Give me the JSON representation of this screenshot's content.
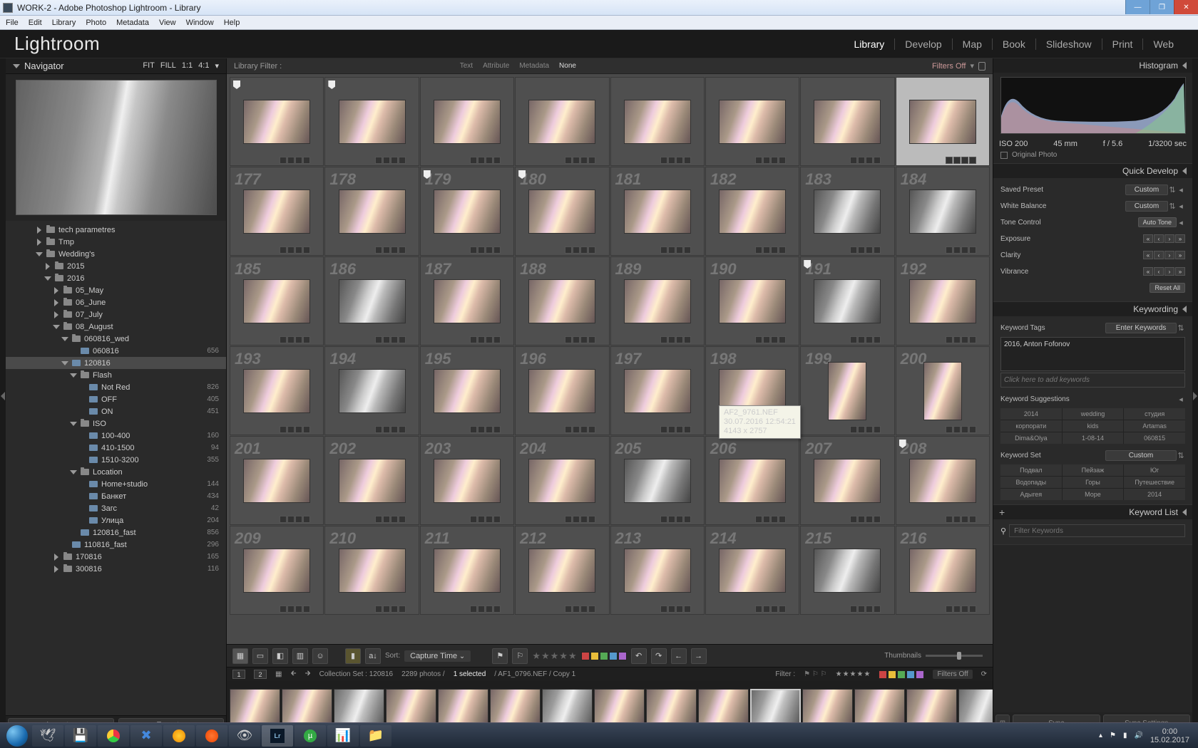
{
  "window": {
    "title": "WORK-2 - Adobe Photoshop Lightroom - Library",
    "menus": [
      "File",
      "Edit",
      "Library",
      "Photo",
      "Metadata",
      "View",
      "Window",
      "Help"
    ]
  },
  "brand": "Lightroom",
  "modules": [
    "Library",
    "Develop",
    "Map",
    "Book",
    "Slideshow",
    "Print",
    "Web"
  ],
  "activeModule": "Library",
  "navigator": {
    "title": "Navigator",
    "opts": [
      "FIT",
      "FILL",
      "1:1",
      "4:1"
    ]
  },
  "folders": [
    {
      "d": 3,
      "exp": "r",
      "ico": "f",
      "name": "tech parametres",
      "cnt": ""
    },
    {
      "d": 3,
      "exp": "r",
      "ico": "f",
      "name": "Tmp",
      "cnt": ""
    },
    {
      "d": 3,
      "exp": "d",
      "ico": "f",
      "name": "Wedding's",
      "cnt": ""
    },
    {
      "d": 4,
      "exp": "r",
      "ico": "f",
      "name": "2015",
      "cnt": ""
    },
    {
      "d": 4,
      "exp": "d",
      "ico": "f",
      "name": "2016",
      "cnt": ""
    },
    {
      "d": 5,
      "exp": "r",
      "ico": "f",
      "name": "05_May",
      "cnt": ""
    },
    {
      "d": 5,
      "exp": "r",
      "ico": "f",
      "name": "06_June",
      "cnt": ""
    },
    {
      "d": 5,
      "exp": "r",
      "ico": "f",
      "name": "07_July",
      "cnt": ""
    },
    {
      "d": 5,
      "exp": "d",
      "ico": "f",
      "name": "08_August",
      "cnt": ""
    },
    {
      "d": 6,
      "exp": "d",
      "ico": "f",
      "name": "060816_wed",
      "cnt": ""
    },
    {
      "d": 7,
      "exp": "",
      "ico": "s",
      "name": "060816",
      "cnt": "656"
    },
    {
      "d": 6,
      "exp": "d",
      "ico": "s",
      "name": "120816",
      "cnt": "",
      "sel": true
    },
    {
      "d": 7,
      "exp": "d",
      "ico": "f",
      "name": "Flash",
      "cnt": ""
    },
    {
      "d": 8,
      "exp": "",
      "ico": "s",
      "name": "Not Red",
      "cnt": "826"
    },
    {
      "d": 8,
      "exp": "",
      "ico": "s",
      "name": "OFF",
      "cnt": "405"
    },
    {
      "d": 8,
      "exp": "",
      "ico": "s",
      "name": "ON",
      "cnt": "451"
    },
    {
      "d": 7,
      "exp": "d",
      "ico": "f",
      "name": "ISO",
      "cnt": ""
    },
    {
      "d": 8,
      "exp": "",
      "ico": "s",
      "name": "100-400",
      "cnt": "160"
    },
    {
      "d": 8,
      "exp": "",
      "ico": "s",
      "name": "410-1500",
      "cnt": "94"
    },
    {
      "d": 8,
      "exp": "",
      "ico": "s",
      "name": "1510-3200",
      "cnt": "355"
    },
    {
      "d": 7,
      "exp": "d",
      "ico": "f",
      "name": "Location",
      "cnt": ""
    },
    {
      "d": 8,
      "exp": "",
      "ico": "s",
      "name": "Home+studio",
      "cnt": "144"
    },
    {
      "d": 8,
      "exp": "",
      "ico": "s",
      "name": "Банкет",
      "cnt": "434"
    },
    {
      "d": 8,
      "exp": "",
      "ico": "s",
      "name": "Загс",
      "cnt": "42"
    },
    {
      "d": 8,
      "exp": "",
      "ico": "s",
      "name": "Улица",
      "cnt": "204"
    },
    {
      "d": 7,
      "exp": "",
      "ico": "s",
      "name": "120816_fast",
      "cnt": "856"
    },
    {
      "d": 6,
      "exp": "",
      "ico": "s",
      "name": "110816_fast",
      "cnt": "296"
    },
    {
      "d": 5,
      "exp": "r",
      "ico": "f",
      "name": "170816",
      "cnt": "165"
    },
    {
      "d": 5,
      "exp": "r",
      "ico": "f",
      "name": "300816",
      "cnt": "116"
    }
  ],
  "impexp": {
    "import": "Import...",
    "export": "Export..."
  },
  "libFilter": {
    "label": "Library Filter :",
    "tabs": [
      "Text",
      "Attribute",
      "Metadata",
      "None"
    ],
    "active": "None",
    "filtersOff": "Filters Off"
  },
  "grid": {
    "startIndex": 169,
    "selectedIndex": 176,
    "tooltipIndex": 190,
    "rows": [
      [
        {
          "f": 1
        },
        {
          "f": 1
        },
        {
          "f": 0
        },
        {
          "f": 0
        },
        {
          "f": 0
        },
        {
          "f": 0
        },
        {
          "f": 0
        },
        {
          "f": 0
        }
      ],
      [
        {
          "f": 0
        },
        {
          "f": 0
        },
        {
          "f": 1
        },
        {
          "f": 1
        },
        {
          "f": 0
        },
        {
          "f": 0
        },
        {
          "f": 0,
          "bw": 1
        },
        {
          "f": 0,
          "bw": 1
        }
      ],
      [
        {
          "f": 0
        },
        {
          "f": 0,
          "bw": 1
        },
        {
          "f": 0
        },
        {
          "f": 0
        },
        {
          "f": 0
        },
        {
          "f": 0
        },
        {
          "f": 1,
          "bw": 1
        },
        {
          "f": 0
        }
      ],
      [
        {
          "f": 0
        },
        {
          "f": 0,
          "bw": 1
        },
        {
          "f": 0
        },
        {
          "f": 0
        },
        {
          "f": 0
        },
        {
          "f": 0
        },
        {
          "f": 0,
          "tall": 1
        },
        {
          "f": 0,
          "tall": 1
        }
      ],
      [
        {
          "f": 0
        },
        {
          "f": 0
        },
        {
          "f": 0
        },
        {
          "f": 0
        },
        {
          "f": 0,
          "bw": 1
        },
        {
          "f": 0
        },
        {
          "f": 0
        },
        {
          "f": 1
        }
      ],
      [
        {
          "f": 0
        },
        {
          "f": 0
        },
        {
          "f": 0
        },
        {
          "f": 0
        },
        {
          "f": 0
        },
        {
          "f": 0
        },
        {
          "f": 0,
          "bw": 1
        },
        {
          "f": 0
        }
      ]
    ]
  },
  "tooltip": {
    "file": "AF2_9761.NEF",
    "date": "30.07.2016 12:54:21",
    "dims": "4143 x 2757"
  },
  "toolbar": {
    "sort_lbl": "Sort:",
    "sort_val": "Capture Time",
    "thumb_lbl": "Thumbnails",
    "colors": [
      "#c44",
      "#e9bd3a",
      "#5a5",
      "#59c",
      "#a6c"
    ]
  },
  "status": {
    "pages": [
      "1",
      "2"
    ],
    "collection": "Collection Set : 120816",
    "count": "2289 photos /",
    "selected": "1 selected",
    "file": "/ AF1_0796.NEF / Copy 1",
    "filter": "Filter :",
    "filtersOff": "Filters Off"
  },
  "filmstrip": {
    "count": 20,
    "selected": 10
  },
  "histogram": {
    "title": "Histogram",
    "iso": "ISO 200",
    "focal": "45 mm",
    "aperture": "f / 5.6",
    "shutter": "1/3200 sec",
    "original": "Original Photo"
  },
  "quickDev": {
    "title": "Quick Develop",
    "savedPreset": {
      "l": "Saved Preset",
      "v": "Custom"
    },
    "wb": {
      "l": "White Balance",
      "v": "Custom"
    },
    "tone": {
      "l": "Tone Control",
      "btn": "Auto Tone"
    },
    "sliders": [
      "Exposure",
      "Clarity",
      "Vibrance"
    ],
    "reset": "Reset All"
  },
  "keywording": {
    "title": "Keywording",
    "tags_lbl": "Keyword Tags",
    "tags_mode": "Enter Keywords",
    "applied": "2016, Anton Fofonov",
    "addHint": "Click here to add keywords",
    "sugg_lbl": "Keyword Suggestions",
    "suggestions": [
      "2014",
      "wedding",
      "студия",
      "корпорати",
      "kids",
      "Artamas",
      "Dima&Olya",
      "1-08-14",
      "060815"
    ],
    "set_lbl": "Keyword Set",
    "set_val": "Custom",
    "setItems": [
      "Подвал",
      "Пейзаж",
      "Юг",
      "Водопады",
      "Горы",
      "Путешествие",
      "Адыгея",
      "Море",
      "2014"
    ]
  },
  "keywordList": {
    "title": "Keyword List",
    "filter": "Filter Keywords"
  },
  "sync": {
    "a": "Sync",
    "b": "Sync Settings"
  },
  "tray": {
    "time": "0:00",
    "date": "15.02.2017"
  }
}
